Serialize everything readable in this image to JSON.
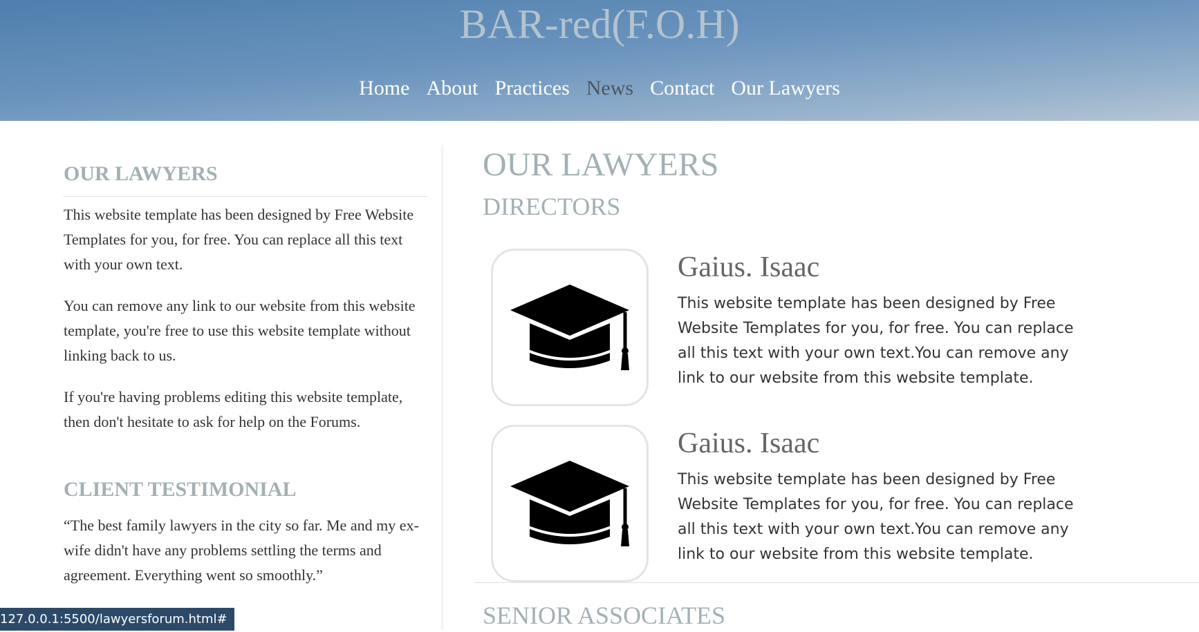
{
  "header": {
    "site_title": "BAR-red(F.O.H)",
    "nav": [
      {
        "label": "Home",
        "active": false
      },
      {
        "label": "About",
        "active": false
      },
      {
        "label": "Practices",
        "active": false
      },
      {
        "label": "News",
        "active": true
      },
      {
        "label": "Contact",
        "active": false
      },
      {
        "label": "Our Lawyers",
        "active": false
      }
    ]
  },
  "sidebar": {
    "our_lawyers": {
      "heading": "OUR LAWYERS",
      "paragraphs": [
        "This website template has been designed by Free Website Templates for you, for free. You can replace all this text with your own text.",
        "You can remove any link to our website from this website template, you're free to use this website template without linking back to us.",
        "If you're having problems editing this website template, then don't hesitate to ask for help on the Forums."
      ]
    },
    "testimonial": {
      "heading": "CLIENT TESTIMONIAL",
      "text": "“The best family lawyers in the city so far. Me and my ex-wife didn't have any problems settling the terms and agreement. Everything went so smoothly.”"
    }
  },
  "main": {
    "title": "OUR LAWYERS",
    "directors_title": "DIRECTORS",
    "directors": [
      {
        "name": "Gaius. Isaac",
        "bio": "This website template has been designed by Free Website Templates for you, for free. You can replace all this text with your own text.You can remove any link to our website from this website template.",
        "icon": "graduation-cap-icon"
      },
      {
        "name": "Gaius. Isaac",
        "bio": "This website template has been designed by Free Website Templates for you, for free. You can replace all this text with your own text.You can remove any link to our website from this website template.",
        "icon": "graduation-cap-icon"
      }
    ],
    "senior_title": "SENIOR ASSOCIATES"
  },
  "status_bar": {
    "url": "127.0.0.1:5500/lawyersforum.html#"
  },
  "colors": {
    "header_gradient_start": "#4f7fae",
    "header_gradient_end": "#b5c5d4",
    "heading_gray": "#a3b0b4",
    "active_nav": "#4a5560",
    "status_bar": "#2c4a68"
  }
}
